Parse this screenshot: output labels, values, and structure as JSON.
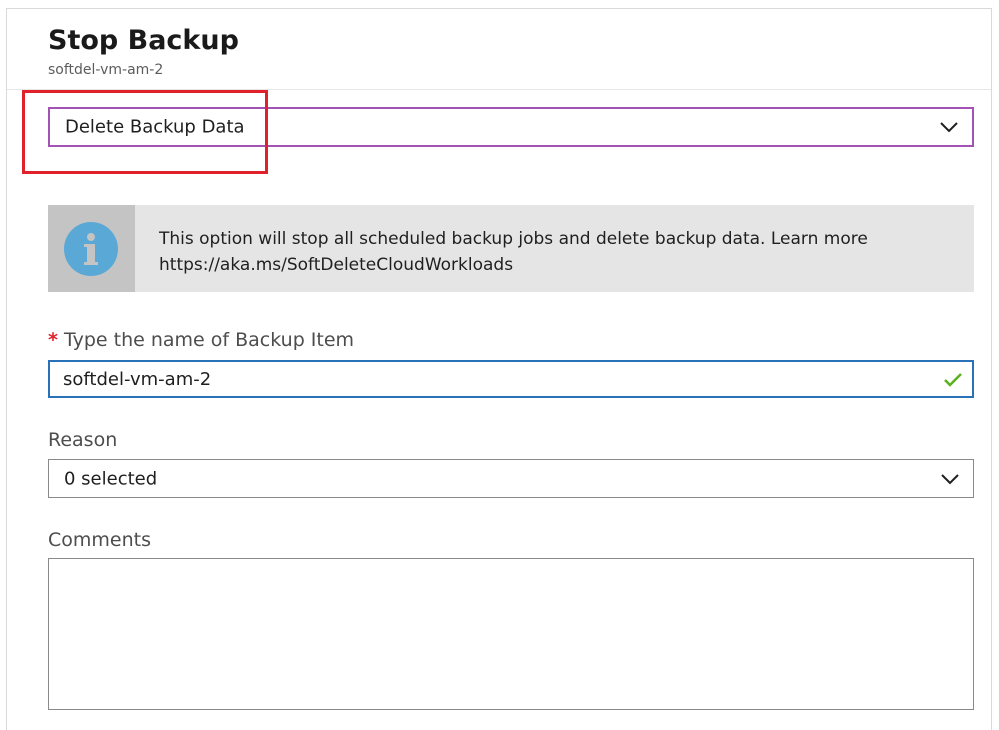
{
  "blade": {
    "title": "Stop Backup",
    "subtitle": "softdel-vm-am-2"
  },
  "mode_select": {
    "value": "Delete Backup Data",
    "icon": "chevron-down-icon"
  },
  "info_banner": {
    "icon": "info-icon",
    "line1": "This option will stop all scheduled backup jobs and delete backup data. Learn more",
    "line2": "https://aka.ms/SoftDeleteCloudWorkloads"
  },
  "backup_item_name": {
    "required_marker": "*",
    "label": "Type the name of Backup Item",
    "value": "softdel-vm-am-2",
    "status_icon": "checkmark-icon"
  },
  "reason": {
    "label": "Reason",
    "value": "0 selected",
    "icon": "chevron-down-icon"
  },
  "comments": {
    "label": "Comments",
    "value": ""
  },
  "colors": {
    "highlight": "#e0202a",
    "focus_border": "#a352b6",
    "input_border": "#2a72b8",
    "valid": "#5bb01e",
    "info_icon": "#5aa8d6"
  }
}
